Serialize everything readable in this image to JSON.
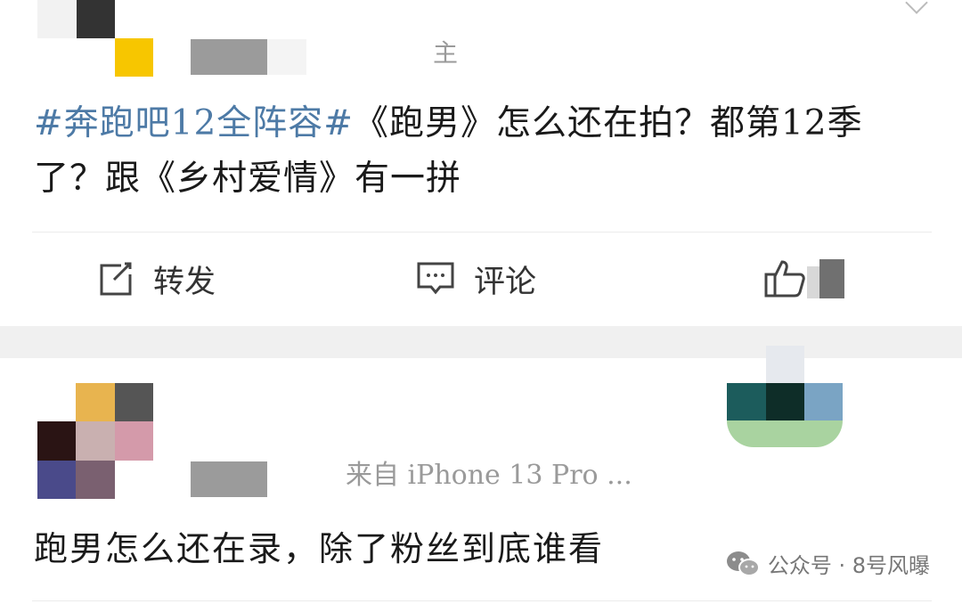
{
  "post": {
    "author_badge": "主",
    "hashtag": "#奔跑吧12全阵容#",
    "text_after_hashtag": "《跑男》怎么还在拍？都第12季了？跟《乡村爱情》有一拼"
  },
  "actions": {
    "repost_label": "转发",
    "comment_label": "评论"
  },
  "reply": {
    "device_text": "来自 iPhone 13 Pro ...",
    "text": "跑男怎么还在录，除了粉丝到底谁看"
  },
  "watermark": {
    "text": "公众号 · 8号风曝"
  },
  "colors": {
    "hashtag": "#4d7aa6",
    "text": "#1a1a1a",
    "muted": "#9a9a9a"
  }
}
